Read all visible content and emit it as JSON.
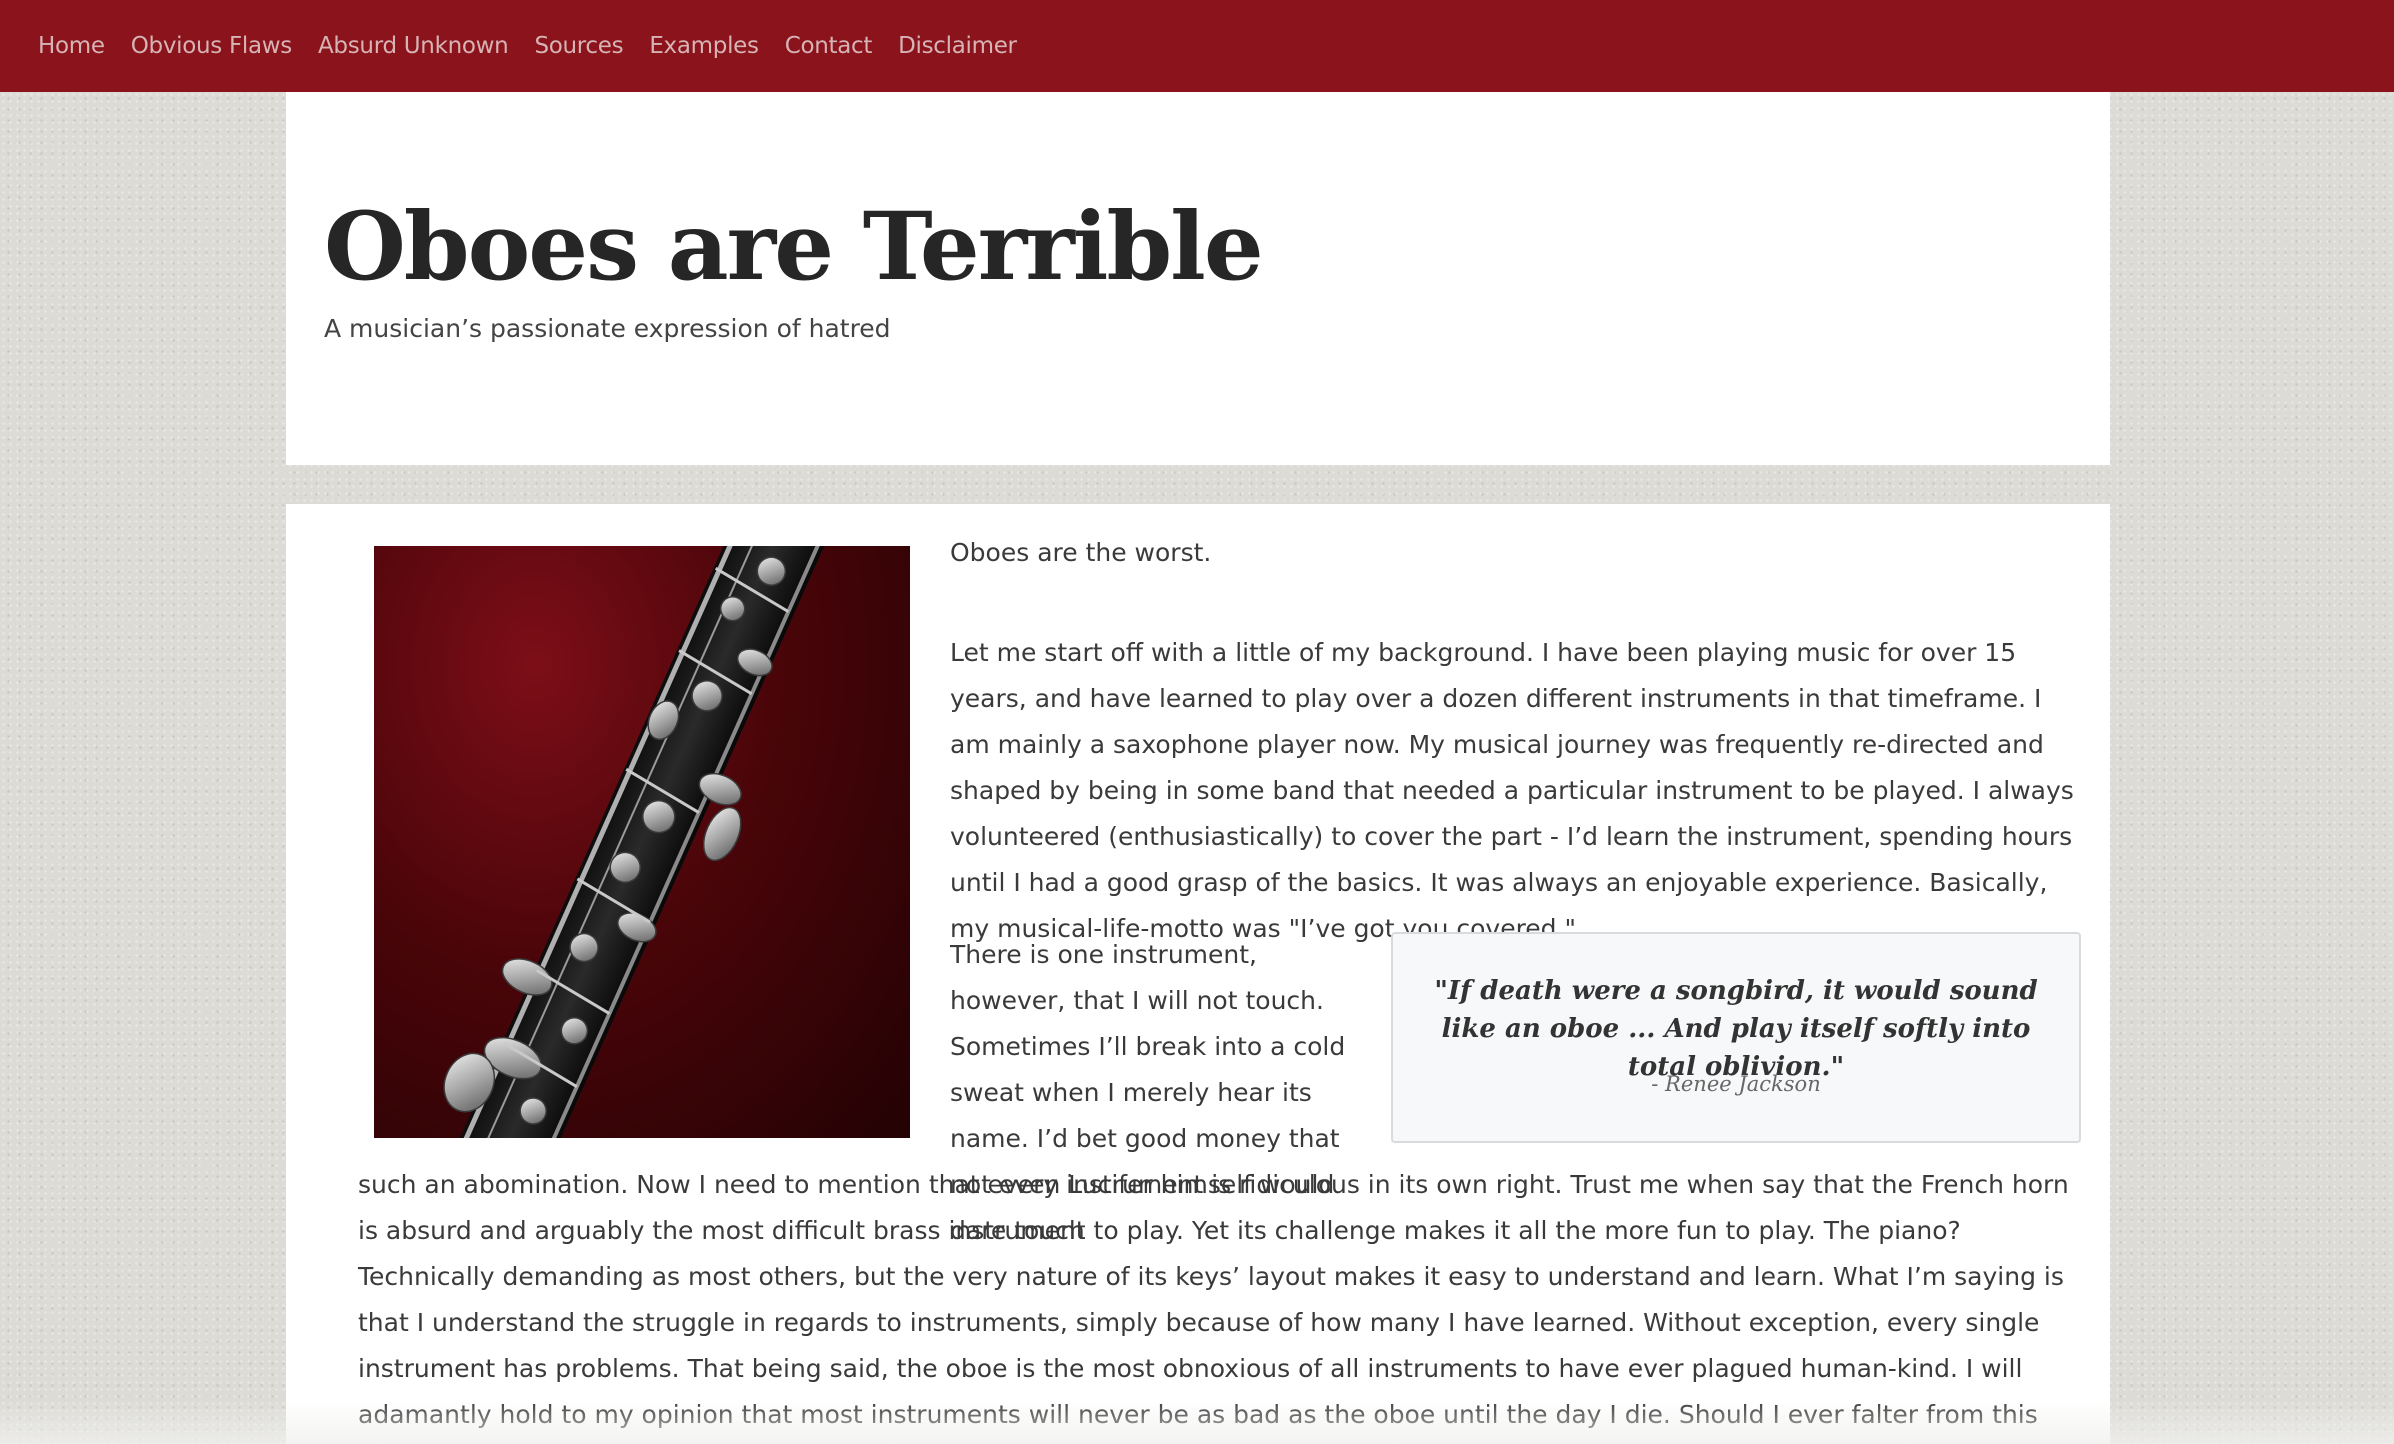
{
  "nav": {
    "items": [
      {
        "label": "Home"
      },
      {
        "label": "Obvious Flaws"
      },
      {
        "label": "Absurd Unknown"
      },
      {
        "label": "Sources"
      },
      {
        "label": "Examples"
      },
      {
        "label": "Contact"
      },
      {
        "label": "Disclaimer"
      }
    ]
  },
  "header": {
    "title": "Oboes are Terrible",
    "subtitle": "A musician’s passionate expression of hatred"
  },
  "content": {
    "intro": "Oboes are the worst.",
    "paragraph1": "Let me start off with a little of my background. I have been playing music for over 15 years, and have learned to play over a dozen different instruments in that timeframe. I am mainly a saxophone player now. My musical journey was frequently re-directed and shaped by being in some band that needed a particular instrument to be played. I always volunteered (enthusiastically) to cover the part - I’d learn the instrument, spending hours until I had a good grasp of the basics. It was always an enjoyable experience. Basically, my musical-life-motto was \"I’ve got you covered.\"",
    "paragraph2_start": "There is one instrument, however, that I will not touch. Sometimes I’ll break into a cold sweat when I merely hear its name. I’d bet good money that not even Lucifer himself would dare touch",
    "paragraph2_rest": "such an abomination. Now I need to mention that every instrument is ridiculous in its own right. Trust me when say that the French horn is absurd and arguably the most difficult brass instrument to play. Yet its challenge makes it all the more fun to play. The piano? Technically demanding as most others, but the very nature of its keys’ layout makes it easy to understand and learn. What I’m saying is that I understand the struggle in regards to instruments, simply because of how many I have learned. Without exception, every single instrument has problems. That being said, the oboe is the most obnoxious of all instruments to have ever plagued human-kind. I will adamantly hold to my opinion that most instruments will never be as bad as the oboe until the day I die. Should I ever falter from this belief - this truth, really - please seek immediate medical attention for me."
  },
  "quote": {
    "text": "\"If death were a songbird, it would sound like an oboe ... And play itself softly into total oblivion.\"",
    "author": "- Renee Jackson"
  },
  "colors": {
    "navbar": "#8b131b",
    "nav_text": "#d6b3b5",
    "page_bg": "#dcdbd6",
    "panel_bg": "#ffffff",
    "quote_bg": "#f7f8f9"
  }
}
